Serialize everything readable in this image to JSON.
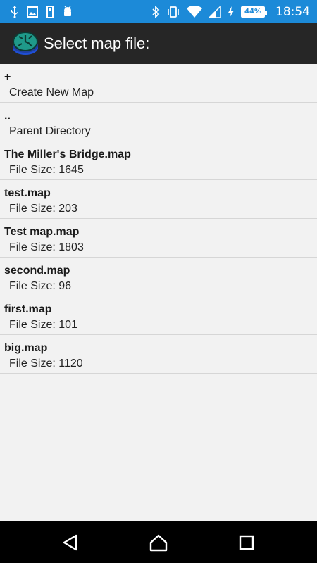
{
  "status_bar": {
    "time": "18:54",
    "battery": "44%",
    "icons": [
      "usb-icon",
      "image-icon",
      "storage-icon",
      "android-icon",
      "bluetooth-icon",
      "vibrate-icon",
      "wifi-icon",
      "signal-icon",
      "charging-icon",
      "battery-icon"
    ]
  },
  "action_bar": {
    "title": "Select map file:",
    "logo_icon": "map-clock-logo"
  },
  "files": [
    {
      "name": "+",
      "detail": "Create New Map"
    },
    {
      "name": "..",
      "detail": "Parent Directory"
    },
    {
      "name": "The Miller's Bridge.map",
      "detail": "File Size: 1645"
    },
    {
      "name": "test.map",
      "detail": "File Size: 203"
    },
    {
      "name": "Test map.map",
      "detail": "File Size: 1803"
    },
    {
      "name": "second.map",
      "detail": "File Size: 96"
    },
    {
      "name": "first.map",
      "detail": "File Size: 101"
    },
    {
      "name": "big.map",
      "detail": "File Size: 1120"
    }
  ],
  "nav_bar": {
    "icons": [
      "back-icon",
      "home-icon",
      "recents-icon"
    ]
  },
  "colors": {
    "status_bar": "#1c8ad8",
    "action_bar": "#262626",
    "background": "#f2f2f2"
  }
}
